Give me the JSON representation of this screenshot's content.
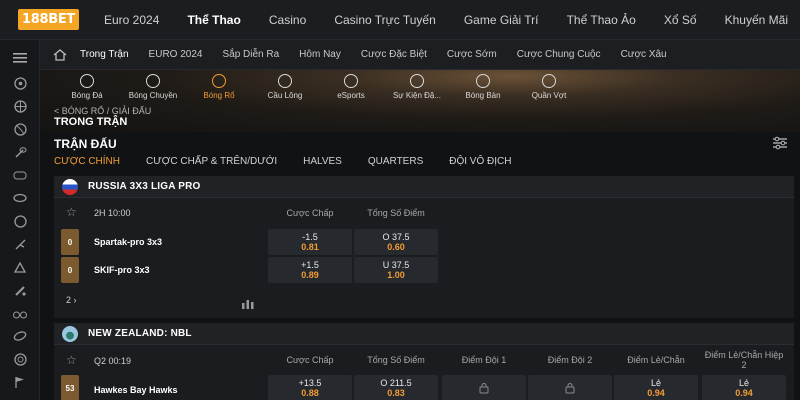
{
  "brand": {
    "logo_text": "188BET"
  },
  "topnav": {
    "items": [
      {
        "label": "Euro 2024",
        "active": false
      },
      {
        "label": "Thể Thao",
        "active": true
      },
      {
        "label": "Casino",
        "active": false
      },
      {
        "label": "Casino Trực Tuyến",
        "active": false
      },
      {
        "label": "Game Giải Trí",
        "active": false
      },
      {
        "label": "Thể Thao Ảo",
        "active": false
      },
      {
        "label": "Xổ Số",
        "active": false
      },
      {
        "label": "Khuyến Mãi",
        "active": false
      }
    ]
  },
  "sidebar": {
    "icons": [
      "menu-icon",
      "soccer-icon",
      "basketball-icon",
      "volleyball-icon",
      "tennis-icon",
      "esports-icon",
      "american-football-icon",
      "baseball-icon",
      "badminton-icon",
      "hockey-icon",
      "cricket-icon",
      "cycling-icon",
      "rugby-icon",
      "darts-icon",
      "golf-icon",
      "flag-icon"
    ]
  },
  "subnav": {
    "items": [
      {
        "label": "Trong Trận",
        "active": true
      },
      {
        "label": "EURO 2024",
        "active": false
      },
      {
        "label": "Sắp Diễn Ra",
        "active": false
      },
      {
        "label": "Hôm Nay",
        "active": false
      },
      {
        "label": "Cược Đặc Biệt",
        "active": false
      },
      {
        "label": "Cược Sớm",
        "active": false
      },
      {
        "label": "Cược Chung Cuộc",
        "active": false
      },
      {
        "label": "Cược Xâu",
        "active": false
      }
    ]
  },
  "sports": [
    {
      "label": "Bóng Đá",
      "icon": "soccer-icon",
      "active": false
    },
    {
      "label": "Bóng Chuyền",
      "icon": "volleyball-icon",
      "active": false
    },
    {
      "label": "Bóng Rổ",
      "icon": "basketball-icon",
      "active": true
    },
    {
      "label": "Cầu Lông",
      "icon": "badminton-icon",
      "active": false
    },
    {
      "label": "eSports",
      "icon": "esports-icon",
      "active": false
    },
    {
      "label": "Sự Kiện Đặ...",
      "icon": "trophy-icon",
      "active": false
    },
    {
      "label": "Bóng Bàn",
      "icon": "table-tennis-icon",
      "active": false
    },
    {
      "label": "Quần Vợt",
      "icon": "tennis-icon",
      "active": false
    }
  ],
  "breadcrumb": "< BÓNG RỔ / GIẢI ĐẤU",
  "page_title": "TRONG TRẬN",
  "section_title": "TRẬN ĐẤU",
  "tabs": [
    {
      "label": "CƯỢC CHÍNH",
      "active": true
    },
    {
      "label": "CƯỢC CHẤP & TRÊN/DƯỚI",
      "active": false
    },
    {
      "label": "HALVES",
      "active": false
    },
    {
      "label": "QUARTERS",
      "active": false
    },
    {
      "label": "ĐỘI VÔ ĐỊCH",
      "active": false
    }
  ],
  "leagues": [
    {
      "name": "RUSSIA 3X3 LIGA PRO",
      "match_time": "2H 10:00",
      "columns": [
        "Cược Chấp",
        "Tổng Số Điểm"
      ],
      "teams": [
        {
          "score": "0",
          "name": "Spartak-pro 3x3",
          "handicap": {
            "line": "-1.5",
            "price": "0.81"
          },
          "total": {
            "line": "O 37.5",
            "price": "0.60"
          }
        },
        {
          "score": "0",
          "name": "SKIF-pro 3x3",
          "handicap": {
            "line": "+1.5",
            "price": "0.89"
          },
          "total": {
            "line": "U 37.5",
            "price": "1.00"
          }
        }
      ],
      "more_label": "2"
    },
    {
      "name": "NEW ZEALAND: NBL",
      "match_time": "Q2 00:19",
      "columns": [
        "Cược Chấp",
        "Tổng Số Điểm",
        "Điểm Đội 1",
        "Điểm Đội 2",
        "Điểm Lẻ/Chẵn",
        "Điểm Lẻ/Chẵn Hiệp 2"
      ],
      "teams": [
        {
          "score": "53",
          "name": "Hawkes Bay Hawks",
          "handicap": {
            "line": "+13.5",
            "price": "0.88"
          },
          "total": {
            "line": "O 211.5",
            "price": "0.83"
          },
          "odd_even": {
            "line": "Lẻ",
            "price": "0.94"
          },
          "odd_even_h2": {
            "line": "Lẻ",
            "price": "0.94"
          }
        }
      ]
    }
  ]
}
